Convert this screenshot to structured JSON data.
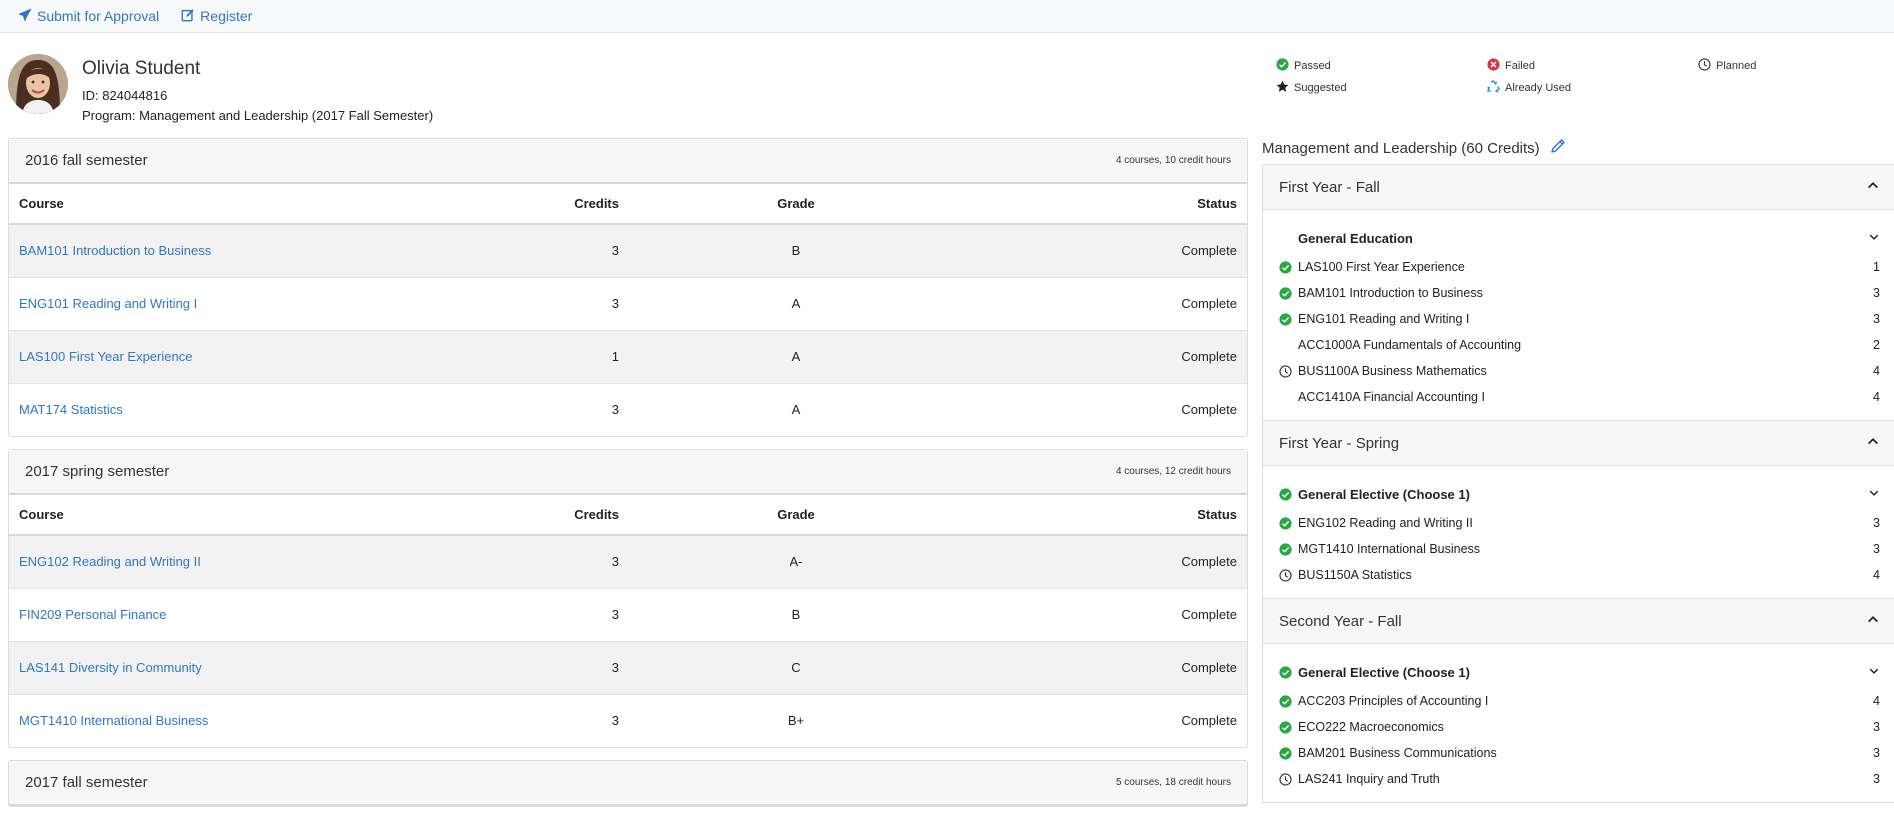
{
  "toolbar": {
    "submit_label": "Submit for Approval",
    "register_label": "Register"
  },
  "student": {
    "name": "Olivia Student",
    "id_line": "ID: 824044816",
    "program_line": "Program: Management and Leadership (2017 Fall Semester)"
  },
  "legend": {
    "passed": "Passed",
    "failed": "Failed",
    "planned": "Planned",
    "suggested": "Suggested",
    "already_used": "Already Used"
  },
  "semesters": [
    {
      "title": "2016 fall semester",
      "meta": "4 courses, 10 credit hours",
      "columns": [
        "Course",
        "Credits",
        "Grade",
        "Status"
      ],
      "rows": [
        {
          "course": "BAM101 Introduction to Business",
          "credits": "3",
          "grade": "B",
          "status": "Complete"
        },
        {
          "course": "ENG101 Reading and Writing I",
          "credits": "3",
          "grade": "A",
          "status": "Complete"
        },
        {
          "course": "LAS100 First Year Experience",
          "credits": "1",
          "grade": "A",
          "status": "Complete"
        },
        {
          "course": "MAT174 Statistics",
          "credits": "3",
          "grade": "A",
          "status": "Complete"
        }
      ]
    },
    {
      "title": "2017 spring semester",
      "meta": "4 courses, 12 credit hours",
      "columns": [
        "Course",
        "Credits",
        "Grade",
        "Status"
      ],
      "rows": [
        {
          "course": "ENG102 Reading and Writing II",
          "credits": "3",
          "grade": "A-",
          "status": "Complete"
        },
        {
          "course": "FIN209 Personal Finance",
          "credits": "3",
          "grade": "B",
          "status": "Complete"
        },
        {
          "course": "LAS141 Diversity in Community",
          "credits": "3",
          "grade": "C",
          "status": "Complete"
        },
        {
          "course": "MGT1410 International Business",
          "credits": "3",
          "grade": "B+",
          "status": "Complete"
        }
      ]
    },
    {
      "title": "2017 fall semester",
      "meta": "5 courses, 18 credit hours"
    }
  ],
  "program": {
    "title": "Management and Leadership (60 Credits)",
    "terms": [
      {
        "title": "First Year - Fall",
        "group": {
          "name": "General Education",
          "icon": "none"
        },
        "rows": [
          {
            "icon": "passed",
            "name": "LAS100 First Year Experience",
            "credits": "1"
          },
          {
            "icon": "passed",
            "name": "BAM101 Introduction to Business",
            "credits": "3"
          },
          {
            "icon": "passed",
            "name": "ENG101 Reading and Writing I",
            "credits": "3"
          },
          {
            "icon": "none",
            "name": "ACC1000A Fundamentals of Accounting",
            "credits": "2"
          },
          {
            "icon": "planned",
            "name": "BUS1100A Business Mathematics",
            "credits": "4"
          },
          {
            "icon": "none",
            "name": "ACC1410A Financial Accounting I",
            "credits": "4"
          }
        ]
      },
      {
        "title": "First Year - Spring",
        "group": {
          "name": "General Elective (Choose 1)",
          "icon": "passed"
        },
        "rows": [
          {
            "icon": "passed",
            "name": "ENG102 Reading and Writing II",
            "credits": "3"
          },
          {
            "icon": "passed",
            "name": "MGT1410 International Business",
            "credits": "3"
          },
          {
            "icon": "planned",
            "name": "BUS1150A Statistics",
            "credits": "4"
          }
        ]
      },
      {
        "title": "Second Year - Fall",
        "group": {
          "name": "General Elective (Choose 1)",
          "icon": "passed"
        },
        "rows": [
          {
            "icon": "passed",
            "name": "ACC203 Principles of Accounting I",
            "credits": "4"
          },
          {
            "icon": "passed",
            "name": "ECO222 Macroeconomics",
            "credits": "3"
          },
          {
            "icon": "passed",
            "name": "BAM201 Business Communications",
            "credits": "3"
          },
          {
            "icon": "planned",
            "name": "LAS241 Inquiry and Truth",
            "credits": "3"
          }
        ]
      }
    ]
  },
  "colors": {
    "link": "#2f76c4",
    "passed": "#28a745",
    "failed": "#dc3545",
    "already_used": "#1e88e5"
  }
}
